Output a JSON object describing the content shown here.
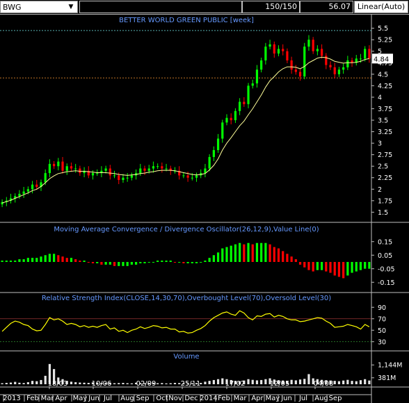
{
  "toolbar": {
    "symbol": "BWG",
    "symbol_dropdown_icon": "triangle-down-icon",
    "count": "150/150",
    "value": "56.07",
    "scale_mode": "Linear(Auto)"
  },
  "price_panel": {
    "title": "BETTER WORLD GREEN PUBLIC [week]",
    "current_price": "4.84",
    "yticks": [
      "5.5",
      "5.25",
      "5",
      "4.75",
      "4.5",
      "4.25",
      "4",
      "3.75",
      "3.5",
      "3.25",
      "3",
      "2.75",
      "2.5",
      "2.25",
      "2",
      "1.75",
      "1.5"
    ]
  },
  "macd_panel": {
    "title": "Moving Average Convergence / Divergence Oscillator(26,12,9),Value Line(0)",
    "yticks": [
      "0.15",
      "0.05",
      "-0.05",
      "-0.15"
    ]
  },
  "rsi_panel": {
    "title": "Relative Strength Index(CLOSE,14,30,70),Overbought Level(70),Oversold Level(30)",
    "yticks": [
      "90",
      "70",
      "50",
      "30"
    ]
  },
  "volume_panel": {
    "title": "Volume",
    "yticks": [
      "1,144M",
      "381M"
    ]
  },
  "xaxis": {
    "date_labels": [
      "18/03",
      "10/06",
      "02/09",
      "25/11",
      "17/02",
      "12/05",
      "04/08"
    ],
    "month_labels": [
      "2013",
      "Feb",
      "Mar",
      "Apr",
      "May",
      "Jun",
      "Jul",
      "Aug",
      "Sep",
      "Oct",
      "Nov",
      "Dec",
      "2014",
      "Feb",
      "Mar",
      "Apr",
      "May",
      "Jun",
      "Jul",
      "Aug",
      "Sep"
    ]
  },
  "colors": {
    "up": "#00ff00",
    "down": "#ff0000",
    "ma": "#ffff99",
    "rsi": "#ffff00",
    "panel_title": "#6699ff",
    "text": "#ffffff"
  },
  "chart_data": [
    {
      "type": "candlestick",
      "title": "BETTER WORLD GREEN PUBLIC [week]",
      "x_weeks": 86,
      "close": [
        1.72,
        1.75,
        1.8,
        1.85,
        1.9,
        1.95,
        2.0,
        2.1,
        2.05,
        2.15,
        2.35,
        2.55,
        2.5,
        2.6,
        2.4,
        2.5,
        2.45,
        2.45,
        2.35,
        2.4,
        2.3,
        2.35,
        2.35,
        2.4,
        2.45,
        2.3,
        2.3,
        2.2,
        2.25,
        2.25,
        2.3,
        2.35,
        2.45,
        2.4,
        2.45,
        2.5,
        2.5,
        2.45,
        2.45,
        2.4,
        2.4,
        2.3,
        2.3,
        2.25,
        2.25,
        2.3,
        2.35,
        2.45,
        2.7,
        2.85,
        3.1,
        3.45,
        3.55,
        3.5,
        3.7,
        3.9,
        3.85,
        4.25,
        4.3,
        4.6,
        4.8,
        5.1,
        5.15,
        4.95,
        5.05,
        5.0,
        4.8,
        4.6,
        4.55,
        4.45,
        5.1,
        5.25,
        5.0,
        5.05,
        4.9,
        4.7,
        4.65,
        4.5,
        4.6,
        4.65,
        4.8,
        4.75,
        4.84,
        4.84,
        5.05,
        4.84
      ],
      "moving_average": [
        1.7,
        1.73,
        1.76,
        1.8,
        1.84,
        1.88,
        1.92,
        1.97,
        2.0,
        2.06,
        2.14,
        2.23,
        2.29,
        2.34,
        2.36,
        2.38,
        2.39,
        2.4,
        2.39,
        2.39,
        2.38,
        2.37,
        2.36,
        2.36,
        2.36,
        2.35,
        2.34,
        2.32,
        2.31,
        2.3,
        2.31,
        2.32,
        2.34,
        2.35,
        2.37,
        2.38,
        2.4,
        2.41,
        2.41,
        2.41,
        2.4,
        2.38,
        2.36,
        2.34,
        2.32,
        2.31,
        2.32,
        2.34,
        2.42,
        2.52,
        2.66,
        2.85,
        3.0,
        3.12,
        3.25,
        3.38,
        3.48,
        3.62,
        3.75,
        3.9,
        4.05,
        4.22,
        4.36,
        4.45,
        4.55,
        4.62,
        4.66,
        4.66,
        4.65,
        4.62,
        4.67,
        4.75,
        4.8,
        4.85,
        4.87,
        4.86,
        4.83,
        4.78,
        4.76,
        4.74,
        4.75,
        4.75,
        4.76,
        4.78,
        4.82,
        4.84
      ],
      "ylim": [
        1.4,
        5.6
      ]
    },
    {
      "type": "bar",
      "title": "Moving Average Convergence / Divergence Oscillator(26,12,9),Value Line(0)",
      "values": [
        0.01,
        0.01,
        0.01,
        0.01,
        0.02,
        0.02,
        0.03,
        0.03,
        0.03,
        0.04,
        0.05,
        0.06,
        0.06,
        0.05,
        0.04,
        0.03,
        0.03,
        0.02,
        0.01,
        0.01,
        0.0,
        -0.01,
        -0.01,
        -0.02,
        -0.02,
        -0.02,
        -0.03,
        -0.03,
        -0.03,
        -0.03,
        -0.02,
        -0.02,
        -0.01,
        -0.01,
        0.0,
        0.0,
        0.01,
        0.01,
        0.01,
        0.01,
        0.0,
        0.0,
        -0.01,
        -0.01,
        -0.01,
        -0.01,
        0.0,
        0.01,
        0.03,
        0.05,
        0.07,
        0.1,
        0.11,
        0.12,
        0.13,
        0.14,
        0.13,
        0.14,
        0.13,
        0.14,
        0.14,
        0.14,
        0.13,
        0.11,
        0.1,
        0.08,
        0.06,
        0.04,
        0.02,
        -0.02,
        -0.04,
        -0.06,
        -0.07,
        -0.06,
        -0.06,
        -0.07,
        -0.08,
        -0.1,
        -0.11,
        -0.12,
        -0.1,
        -0.08,
        -0.07,
        -0.06,
        -0.05,
        -0.05
      ],
      "ylim": [
        -0.2,
        0.2
      ]
    },
    {
      "type": "line",
      "title": "Relative Strength Index(CLOSE,14,30,70),Overbought Level(70),Oversold Level(30)",
      "values": [
        48,
        55,
        62,
        66,
        64,
        60,
        58,
        52,
        49,
        50,
        60,
        72,
        68,
        70,
        66,
        60,
        62,
        60,
        56,
        58,
        55,
        57,
        55,
        58,
        60,
        52,
        54,
        48,
        50,
        46,
        50,
        52,
        56,
        53,
        55,
        58,
        57,
        54,
        55,
        52,
        52,
        47,
        48,
        45,
        46,
        50,
        53,
        58,
        66,
        72,
        76,
        80,
        82,
        78,
        76,
        84,
        80,
        72,
        68,
        75,
        74,
        78,
        79,
        73,
        76,
        74,
        70,
        68,
        68,
        65,
        66,
        68,
        70,
        72,
        71,
        66,
        62,
        55,
        56,
        57,
        60,
        58,
        56,
        52,
        60,
        56
      ],
      "overbought": 70,
      "oversold": 30,
      "ylim": [
        20,
        100
      ]
    },
    {
      "type": "bar",
      "title": "Volume",
      "values": [
        60,
        80,
        100,
        140,
        90,
        70,
        120,
        200,
        180,
        250,
        500,
        1200,
        900,
        400,
        300,
        200,
        150,
        120,
        100,
        90,
        80,
        110,
        90,
        70,
        80,
        90,
        60,
        70,
        80,
        60,
        50,
        90,
        70,
        60,
        80,
        90,
        60,
        70,
        50,
        60,
        80,
        70,
        60,
        50,
        60,
        70,
        80,
        150,
        200,
        250,
        300,
        350,
        300,
        250,
        200,
        180,
        220,
        300,
        260,
        230,
        250,
        300,
        350,
        280,
        240,
        220,
        200,
        260,
        230,
        280,
        320,
        600,
        350,
        300,
        260,
        240,
        220,
        200,
        180,
        220,
        260,
        200,
        180,
        240,
        300,
        220
      ],
      "unit": "M",
      "ylim": [
        0,
        1400
      ]
    }
  ]
}
